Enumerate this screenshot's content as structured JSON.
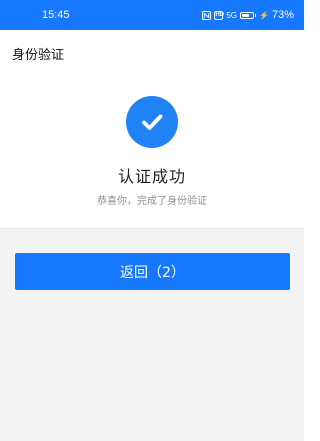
{
  "status_bar": {
    "time": "15:45",
    "hd_label": "HD",
    "signal_label": "5G",
    "battery_percent": "73%",
    "bolt_icon": "⚡",
    "colors": {
      "background": "#1677ff",
      "text": "#ffffff"
    },
    "icons": [
      "nfc-icon",
      "hd-icon",
      "signal-icon",
      "battery-icon",
      "charging-icon"
    ]
  },
  "header": {
    "title": "身份验证"
  },
  "result": {
    "icon": "checkmark-icon",
    "title": "认证成功",
    "subtitle": "恭喜你，完成了身份验证",
    "accent_color": "#1f83f5"
  },
  "actions": {
    "return_label": "返回（2）",
    "button_color": "#1677ff"
  }
}
